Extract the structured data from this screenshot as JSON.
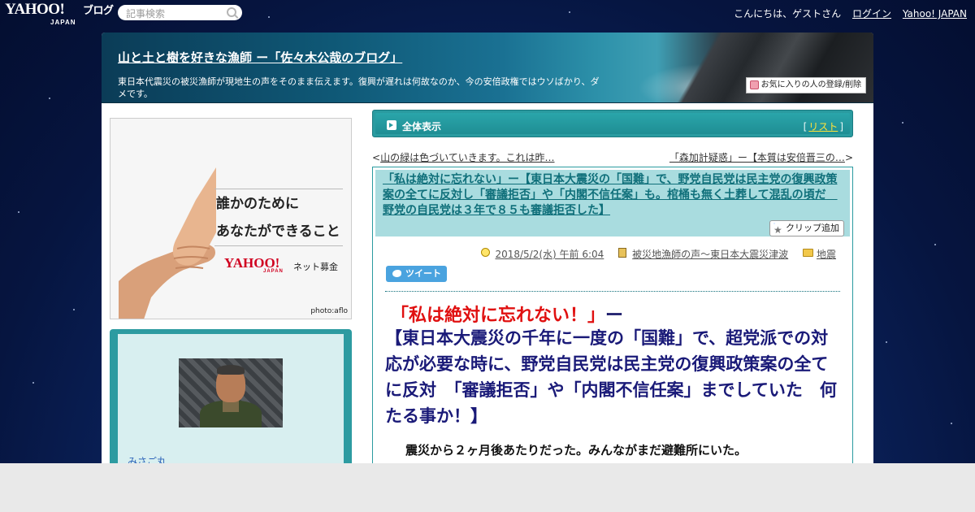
{
  "topbar": {
    "logo_main": "YAHOO!",
    "logo_sub": "JAPAN",
    "logo_blog": "ブログ",
    "search_placeholder": "記事検索",
    "greeting": "こんにちは、ゲストさん",
    "login": "ログイン",
    "yahoo_japan": "Yahoo! JAPAN"
  },
  "header": {
    "title": "山と土と樹を好きな漁師 ー「佐々木公哉のブログ」",
    "description": "東日本代震災の被災漁師が現地生の声をそのまま伝えます。復興が遅れは何故なのか、今の安倍政権ではウソばかり、ダメです。",
    "favorite_button": "お気に入りの人の登録/削除"
  },
  "sidebar": {
    "ad": {
      "line1": "誰かのために",
      "line2": "あなたができること",
      "brand": "YAHOO!",
      "brand_sub": "JAPAN",
      "service": "ネット募金",
      "credit": "photo:aflo"
    },
    "profile": {
      "name": "みさご丸"
    }
  },
  "main": {
    "view_bar": {
      "label": "全体表示",
      "list_open": "[",
      "list_link": "リスト",
      "list_close": "]"
    },
    "nav": {
      "prev_arrow": "<",
      "prev_title": "山の緑は色づいていきます。これは昨…",
      "next_title": "「森加計疑惑」ー【本質は安倍晋三の…",
      "next_arrow": ">"
    },
    "article": {
      "title": "「私は絶対に忘れない」ー【東日本大震災の「国難」で、野党自民党は民主党の復興政策案の全てに反対し「審議拒否」や「内閣不信任案」も。棺桶も無く土葬して混乱の頃だ　野党の自民党は３年で８５も審議拒否した】",
      "clip_button": "クリップ追加",
      "date": "2018/5/2(水) 午前 6:04",
      "book": "被災地漁師の声～東日本大震災津波",
      "category": "地震",
      "tweet": "ツイート",
      "headline_red": "「私は絶対に忘れない！」",
      "headline_dash": "ー",
      "headline_blue": "【東日本大震災の千年に一度の「国難」で、超党派での対応が必要な時に、野党自民党は民主党の復興政策案の全てに反対　「審議拒否」や「内閣不信任案」までしていた　何たる事か！】",
      "body_first_line": "震災から２ヶ月後あたりだった。みんながまだ避難所にいた。"
    }
  },
  "colors": {
    "teal": "#2a9ba0",
    "link_teal": "#0f6f7a",
    "headline_red": "#e01010",
    "headline_blue": "#1a1a78"
  }
}
